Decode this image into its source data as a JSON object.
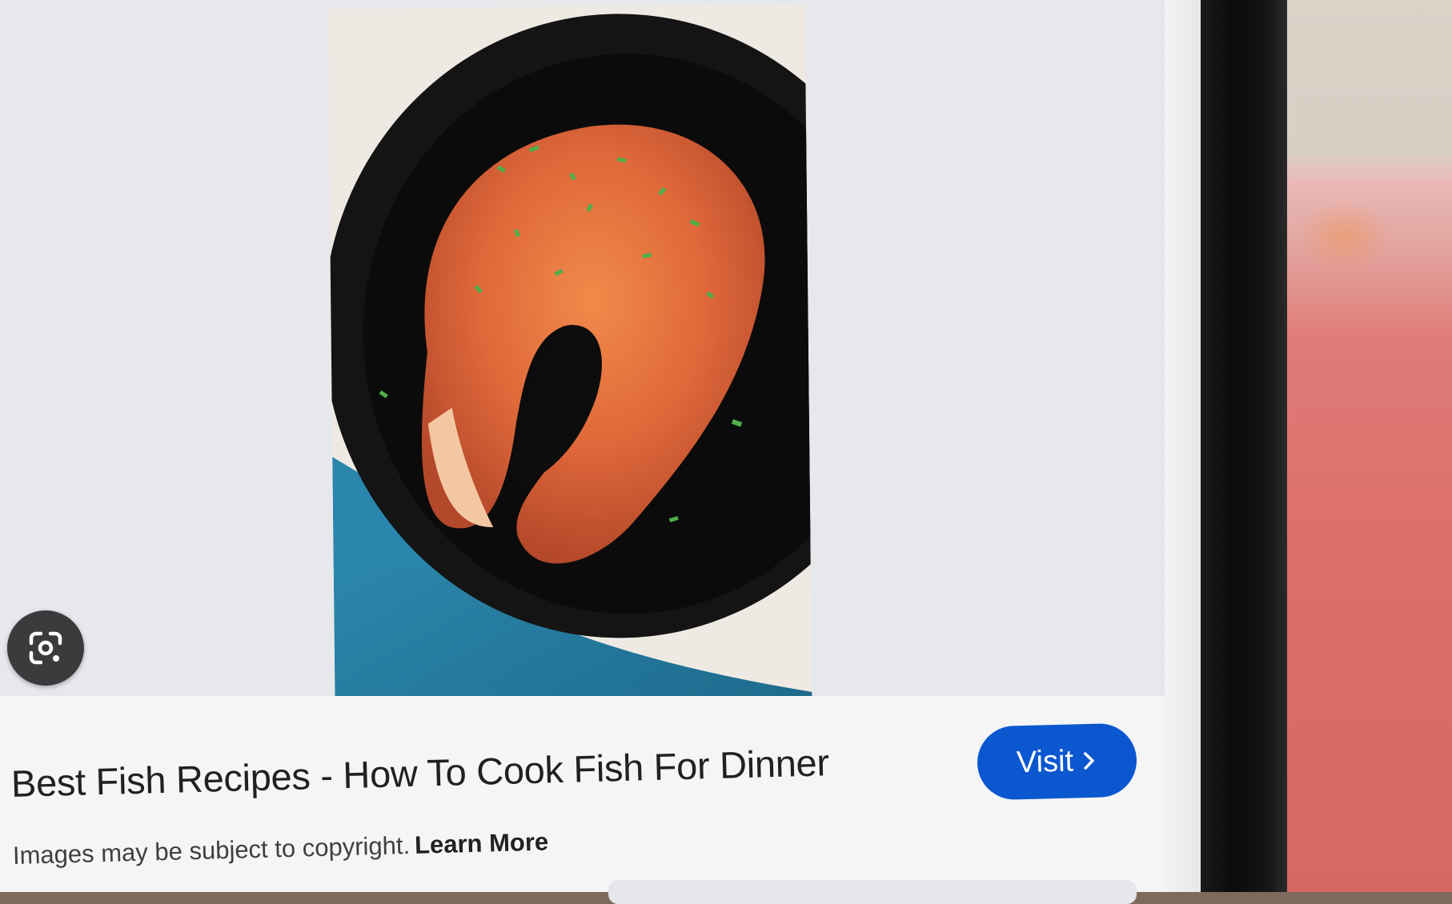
{
  "result": {
    "title": "Best Fish Recipes - How To Cook Fish For Dinner",
    "visit_label": "Visit"
  },
  "notice": {
    "text": "Images may be subject to copyright.",
    "link_label": "Learn More"
  },
  "icons": {
    "lens": "google-lens-icon",
    "visit_chevron": "chevron-right-icon"
  },
  "colors": {
    "visit_button": "#0b57d0",
    "lens_button": "#3a3b3d",
    "screen_background": "#eceef2"
  }
}
